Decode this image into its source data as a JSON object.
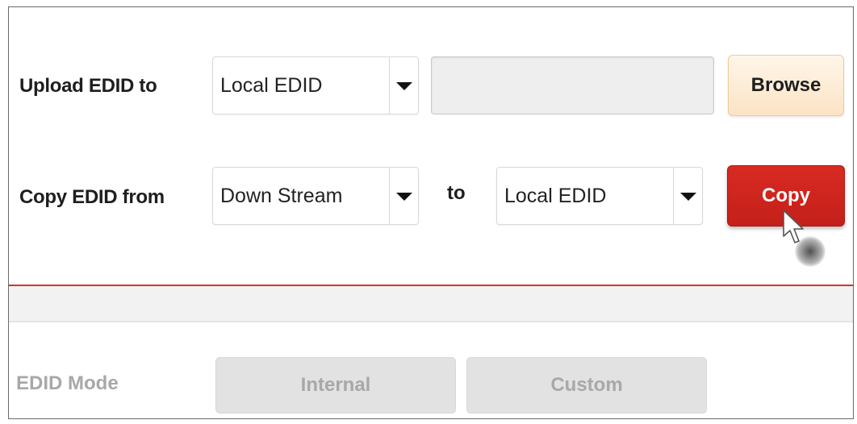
{
  "upload": {
    "label": "Upload EDID to",
    "target": {
      "selected": "Local EDID"
    },
    "file_path": "",
    "browse_label": "Browse"
  },
  "copy": {
    "label": "Copy EDID from",
    "source": {
      "selected": "Down Stream"
    },
    "to_label": "to",
    "destination": {
      "selected": "Local EDID"
    },
    "copy_label": "Copy"
  },
  "mode": {
    "label": "EDID Mode",
    "options": [
      {
        "label": "Internal"
      },
      {
        "label": "Custom"
      }
    ]
  },
  "colors": {
    "accent_red": "#d32a22",
    "browse_bg": "#fdeeda",
    "disabled_text": "#a8a8a8",
    "disabled_bg": "#e2e2e2"
  },
  "icons": {
    "dropdown": "caret-down-icon",
    "pointer": "mouse-pointer-icon"
  }
}
